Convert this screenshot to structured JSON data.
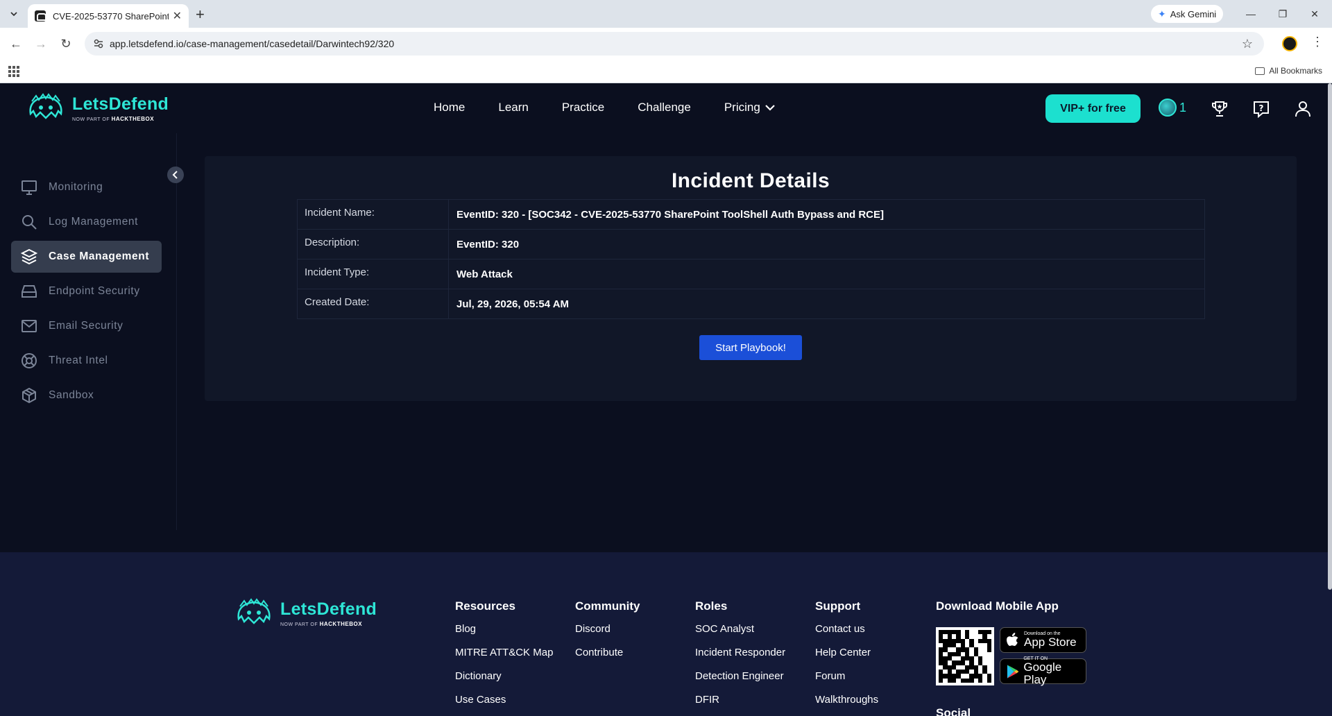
{
  "browser": {
    "tab_title": "CVE-2025-53770 SharePoint To",
    "gemini_label": "Ask Gemini",
    "url": "app.letsdefend.io/case-management/casedetail/Darwintech92/320",
    "all_bookmarks": "All Bookmarks"
  },
  "brand": {
    "name": "LetsDefend",
    "sub_prefix": "NOW PART OF",
    "sub_brand": "HACKTHEBOX",
    "accent": "#2ee6d6"
  },
  "nav": {
    "items": [
      "Home",
      "Learn",
      "Practice",
      "Challenge",
      "Pricing"
    ],
    "vip_label": "VIP+ for free",
    "streak_count": "1"
  },
  "sidebar": {
    "items": [
      {
        "label": "Monitoring",
        "icon": "monitor-icon"
      },
      {
        "label": "Log Management",
        "icon": "search-icon"
      },
      {
        "label": "Case Management",
        "icon": "layers-icon",
        "active": true
      },
      {
        "label": "Endpoint Security",
        "icon": "drive-icon"
      },
      {
        "label": "Email Security",
        "icon": "mail-icon"
      },
      {
        "label": "Threat Intel",
        "icon": "lifebuoy-icon"
      },
      {
        "label": "Sandbox",
        "icon": "cube-icon"
      }
    ]
  },
  "incident": {
    "title": "Incident Details",
    "rows": [
      {
        "label": "Incident Name:",
        "value": "EventID: 320 - [SOC342 - CVE-2025-53770 SharePoint ToolShell Auth Bypass and RCE]"
      },
      {
        "label": "Description:",
        "value": "EventID: 320"
      },
      {
        "label": "Incident Type:",
        "value": "Web Attack"
      },
      {
        "label": "Created Date:",
        "value": "Jul, 29, 2026, 05:54 AM"
      }
    ],
    "playbook_button": "Start Playbook!",
    "button_color": "#1b4fd8"
  },
  "footer": {
    "columns": [
      {
        "title": "Resources",
        "links": [
          "Blog",
          "MITRE ATT&CK Map",
          "Dictionary",
          "Use Cases"
        ]
      },
      {
        "title": "Community",
        "links": [
          "Discord",
          "Contribute"
        ]
      },
      {
        "title": "Roles",
        "links": [
          "SOC Analyst",
          "Incident Responder",
          "Detection Engineer",
          "DFIR"
        ]
      },
      {
        "title": "Support",
        "links": [
          "Contact us",
          "Help Center",
          "Forum",
          "Walkthroughs"
        ]
      }
    ],
    "app": {
      "title": "Download Mobile App",
      "appstore_small": "Download on the",
      "appstore_big": "App Store",
      "play_small": "GET IT ON",
      "play_big": "Google Play"
    },
    "social_title": "Social"
  }
}
